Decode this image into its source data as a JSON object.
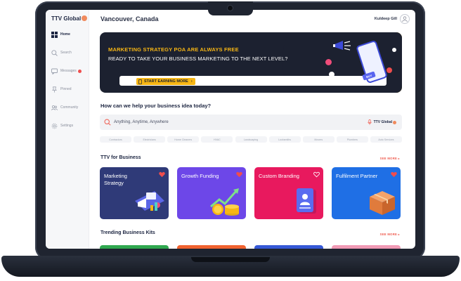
{
  "app": {
    "logo_text": "TTV Global"
  },
  "sidebar": {
    "items": [
      {
        "label": "Home",
        "icon": "grid-icon",
        "active": true
      },
      {
        "label": "Search",
        "icon": "search-icon"
      },
      {
        "label": "Messages",
        "icon": "message-icon",
        "badge": "2"
      },
      {
        "label": "Pinned",
        "icon": "pin-icon"
      },
      {
        "label": "Community",
        "icon": "community-icon"
      },
      {
        "label": "Settings",
        "icon": "gear-icon"
      }
    ]
  },
  "header": {
    "location": "Vancouver, Canada",
    "user_name": "Kuldeep Gill"
  },
  "banner": {
    "headline": "MARKETING STRATEGY POA ARE ALWAYS FREE",
    "subline": "READY TO TAKE YOUR BUSINESS MARKETING TO THE NEXT LEVEL?",
    "cta_label": "START EARNING MORE",
    "buy_tag": "BUY"
  },
  "search": {
    "question": "How can we help your business idea today?",
    "placeholder": "Anything, Anytime, Anywhere",
    "brand": "TTV Global"
  },
  "chips": [
    "Contractors",
    "Electricians",
    "Home Cleaners",
    "HVAC",
    "Landscaping",
    "Locksmiths",
    "Movers",
    "Plumbers",
    "Auto Services"
  ],
  "business": {
    "title": "TTV for Business",
    "see_more": "SEE MORE",
    "cards": [
      {
        "title": "Marketing Strategy",
        "color": "#2f3a78",
        "heart": "filled"
      },
      {
        "title": "Growth Funding",
        "color": "#6d47e8",
        "heart": "filled"
      },
      {
        "title": "Custom Branding",
        "color": "#e8195e",
        "heart": "outline"
      },
      {
        "title": "Fulfilment Partner",
        "color": "#1f6fe5",
        "heart": "filled"
      }
    ]
  },
  "kits": {
    "title": "Trending Business Kits",
    "see_more": "SEE MORE",
    "colors": [
      "#2fa84f",
      "#f0622f",
      "#3558d6",
      "#f09ab5"
    ]
  },
  "colors": {
    "accent_yellow": "#f7b614",
    "dark_navy": "#1c2130",
    "coral": "#ef5a4d"
  }
}
